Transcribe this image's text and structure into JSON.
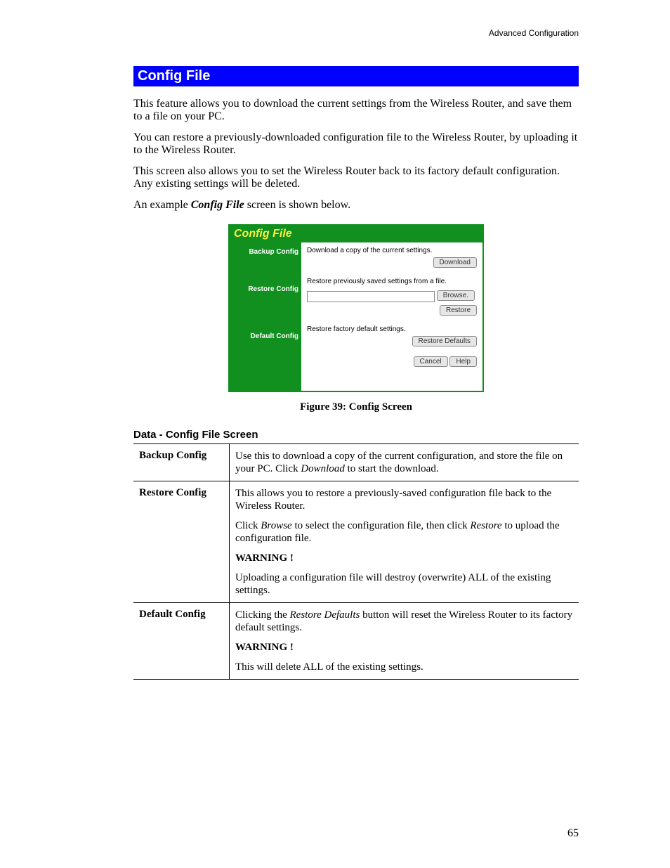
{
  "header": {
    "breadcrumb": "Advanced Configuration"
  },
  "section": {
    "title": "Config File"
  },
  "paragraphs": {
    "p1": "This feature allows you to download the current settings from the Wireless Router, and save them to a file on your PC.",
    "p2": "You can restore a previously-downloaded configuration file to the Wireless Router, by uploading it to the Wireless Router.",
    "p3": "This screen also allows you to set the Wireless Router back to its factory default configuration. Any existing settings will be deleted.",
    "p4_pre": "An example ",
    "p4_em": "Config File",
    "p4_post": " screen is shown below."
  },
  "screenshot": {
    "title": "Config File",
    "left": {
      "backup": "Backup Config",
      "restore": "Restore Config",
      "default": "Default Config"
    },
    "right": {
      "backup_text": "Download a copy of the current settings.",
      "download_btn": "Download",
      "restore_text": "Restore previously saved settings from a file.",
      "browse_btn": "Browse.",
      "restore_btn": "Restore",
      "default_text": "Restore factory default settings.",
      "restore_defaults_btn": "Restore Defaults",
      "cancel_btn": "Cancel",
      "help_btn": "Help"
    }
  },
  "figure_caption": "Figure 39: Config Screen",
  "data_heading": "Data - Config File Screen",
  "table": {
    "backup": {
      "key": "Backup Config",
      "t1a": "Use this to download a copy of the current configuration, and store the file on your PC. Click ",
      "t1em": "Download",
      "t1b": " to start the download."
    },
    "restore": {
      "key": "Restore Config",
      "t1": "This allows you to restore a previously-saved configuration file back to the Wireless Router.",
      "t2a": "Click ",
      "t2em1": "Browse",
      "t2b": " to select the configuration file, then click ",
      "t2em2": "Restore",
      "t2c": " to upload the configuration file.",
      "warn": "WARNING !",
      "t3": "Uploading a configuration file will destroy (overwrite) ALL of the existing settings."
    },
    "default": {
      "key": "Default Config",
      "t1a": "Clicking the ",
      "t1em": "Restore Defaults",
      "t1b": " button will reset the Wireless Router to its factory default settings.",
      "warn": "WARNING !",
      "t2": "This will delete ALL of the existing settings."
    }
  },
  "page_number": "65"
}
